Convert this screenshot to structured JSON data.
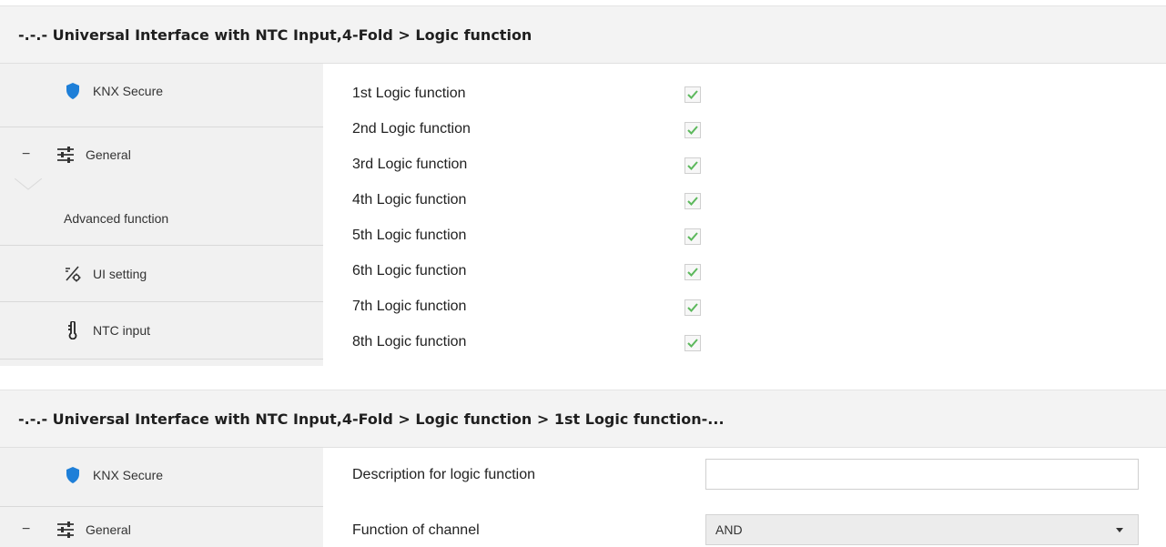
{
  "panel1": {
    "title": "-.-.- Universal Interface with NTC Input,4-Fold > Logic function",
    "sidebar": {
      "items": [
        {
          "label": "KNX Secure",
          "icon": "shield-icon"
        },
        {
          "label": "General",
          "icon": "sliders-icon",
          "collapse": "−"
        },
        {
          "label": "Advanced function"
        },
        {
          "label": "UI setting",
          "icon": "ui-setting-icon"
        },
        {
          "label": "NTC input",
          "icon": "ntc-probe-icon"
        }
      ]
    },
    "rows": [
      {
        "label": "1st Logic function",
        "checked": true
      },
      {
        "label": "2nd Logic function",
        "checked": true
      },
      {
        "label": "3rd Logic function",
        "checked": true
      },
      {
        "label": "4th Logic function",
        "checked": true
      },
      {
        "label": "5th Logic function",
        "checked": true
      },
      {
        "label": "6th Logic function",
        "checked": true
      },
      {
        "label": "7th Logic function",
        "checked": true
      },
      {
        "label": "8th Logic function",
        "checked": true
      }
    ]
  },
  "panel2": {
    "title": "-.-.- Universal Interface with NTC Input,4-Fold > Logic function > 1st Logic function-...",
    "sidebar": {
      "items": [
        {
          "label": "KNX Secure",
          "icon": "shield-icon"
        },
        {
          "label": "General",
          "icon": "sliders-icon",
          "collapse": "−"
        }
      ]
    },
    "fields": {
      "description_label": "Description for logic function",
      "description_value": "",
      "function_label": "Function of channel",
      "function_value": "AND"
    }
  },
  "colors": {
    "titlebar_bg": "#f3f3f3",
    "sidebar_bg": "#f1f1f1",
    "shield": "#1e7fd8",
    "check": "#5cb85c"
  }
}
